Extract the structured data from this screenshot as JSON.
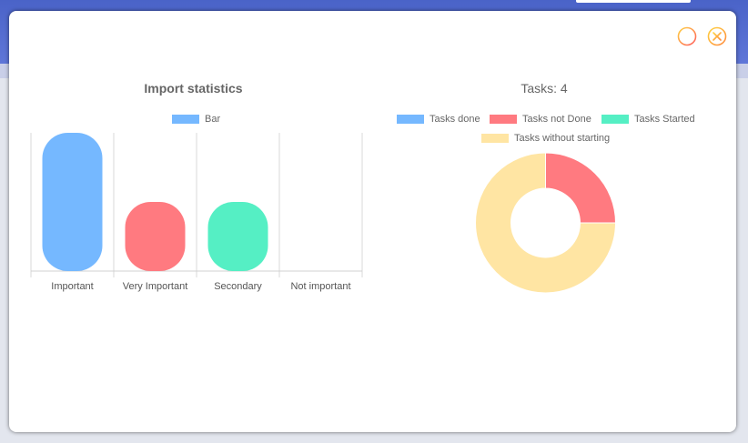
{
  "chart_data": [
    {
      "type": "bar",
      "title": "Import statistics",
      "categories": [
        "Important",
        "Very Important",
        "Secondary",
        "Not important"
      ],
      "series": [
        {
          "name": "Bar",
          "values": [
            1,
            0.5,
            0.5,
            0
          ],
          "colors": [
            "#75b8ff",
            "#ff7a80",
            "#55efc4",
            "#ffe5a3"
          ]
        }
      ],
      "legend": [
        "Bar"
      ],
      "legend_color": "#75b8ff",
      "ylim": [
        0,
        1
      ],
      "grid": true,
      "legend_position": "top"
    },
    {
      "type": "pie",
      "variant": "donut",
      "title": "Tasks: 4",
      "labels": [
        "Tasks done",
        "Tasks not Done",
        "Tasks Started",
        "Tasks without starting"
      ],
      "values": [
        0,
        1,
        0,
        3
      ],
      "colors": [
        "#75b8ff",
        "#ff7a80",
        "#55efc4",
        "#ffe5a3"
      ],
      "legend_position": "top"
    }
  ],
  "window": {
    "minimize_icon": "minus-circle-icon",
    "close_icon": "close-circle-icon"
  }
}
